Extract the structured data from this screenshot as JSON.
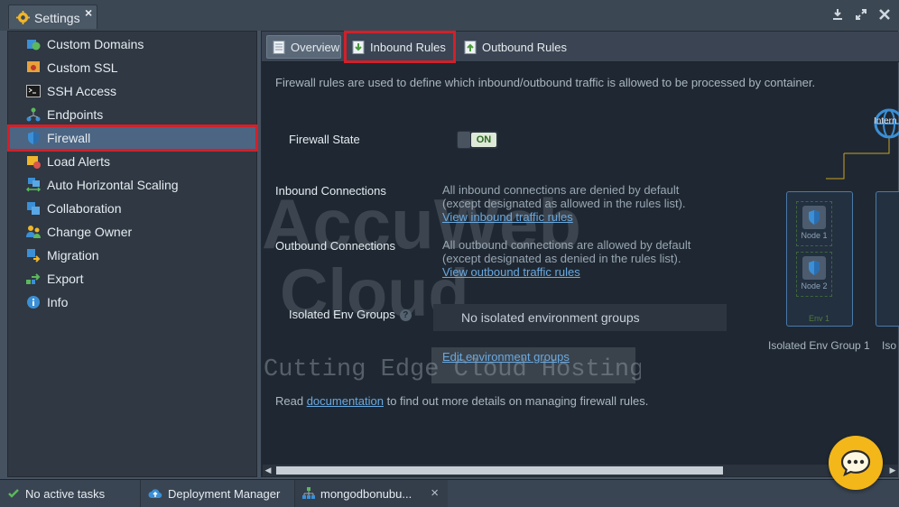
{
  "window": {
    "title": "Settings",
    "close_glyph": "×",
    "controls": [
      "download-icon",
      "expand-icon",
      "close-icon"
    ]
  },
  "sidebar": {
    "items": [
      {
        "label": "Custom Domains",
        "icon": "globe-icon"
      },
      {
        "label": "Custom SSL",
        "icon": "certificate-icon"
      },
      {
        "label": "SSH Access",
        "icon": "terminal-icon"
      },
      {
        "label": "Endpoints",
        "icon": "endpoints-icon"
      },
      {
        "label": "Firewall",
        "icon": "firewall-shield-icon",
        "active": true
      },
      {
        "label": "Load Alerts",
        "icon": "alert-icon"
      },
      {
        "label": "Auto Horizontal Scaling",
        "icon": "scaling-icon"
      },
      {
        "label": "Collaboration",
        "icon": "collaboration-icon"
      },
      {
        "label": "Change Owner",
        "icon": "owner-icon"
      },
      {
        "label": "Migration",
        "icon": "migration-icon"
      },
      {
        "label": "Export",
        "icon": "export-icon"
      },
      {
        "label": "Info",
        "icon": "info-icon"
      }
    ]
  },
  "tabs": {
    "overview": "Overview",
    "inbound": "Inbound Rules",
    "outbound": "Outbound Rules"
  },
  "content": {
    "intro": "Firewall rules are used to define which inbound/outbound traffic is allowed to be processed by container.",
    "firewall_state_label": "Firewall State",
    "toggle_state": "ON",
    "inbound_label": "Inbound Connections",
    "inbound_desc_1": "All inbound connections are denied by default",
    "inbound_desc_2": "(except designated as allowed in the rules list).",
    "inbound_link": "View inbound traffic rules",
    "outbound_label": "Outbound Connections",
    "outbound_desc_1": "All outbound connections are allowed by default",
    "outbound_desc_2": "(except designated as denied in the rules list).",
    "outbound_link": "View outbound traffic rules",
    "isolated_label": "Isolated Env Groups",
    "isolated_help": "?",
    "isolated_value": "No isolated environment groups",
    "edit_groups_link": "Edit environment groups",
    "read_prefix": "Read ",
    "doc_link": "documentation",
    "read_suffix": " to find out more details on managing firewall rules."
  },
  "diagram": {
    "internet_label": "Intern",
    "node1": "Node 1",
    "node2": "Node 2",
    "env1": "Env 1",
    "group1": "Isolated Env Group 1",
    "group2": "Iso"
  },
  "watermark": {
    "line1": "AccuWeb",
    "line2": "Cloud",
    "line3": "Cutting Edge Cloud Hosting"
  },
  "taskbar": {
    "t1": "No active tasks",
    "t2": "Deployment Manager",
    "t3": "mongodbonubu...",
    "t3_close": "×"
  },
  "colors": {
    "accent_red": "#d2202a",
    "link": "#6aa9e0",
    "chat": "#f4b71a",
    "active_item": "#4b6583"
  }
}
